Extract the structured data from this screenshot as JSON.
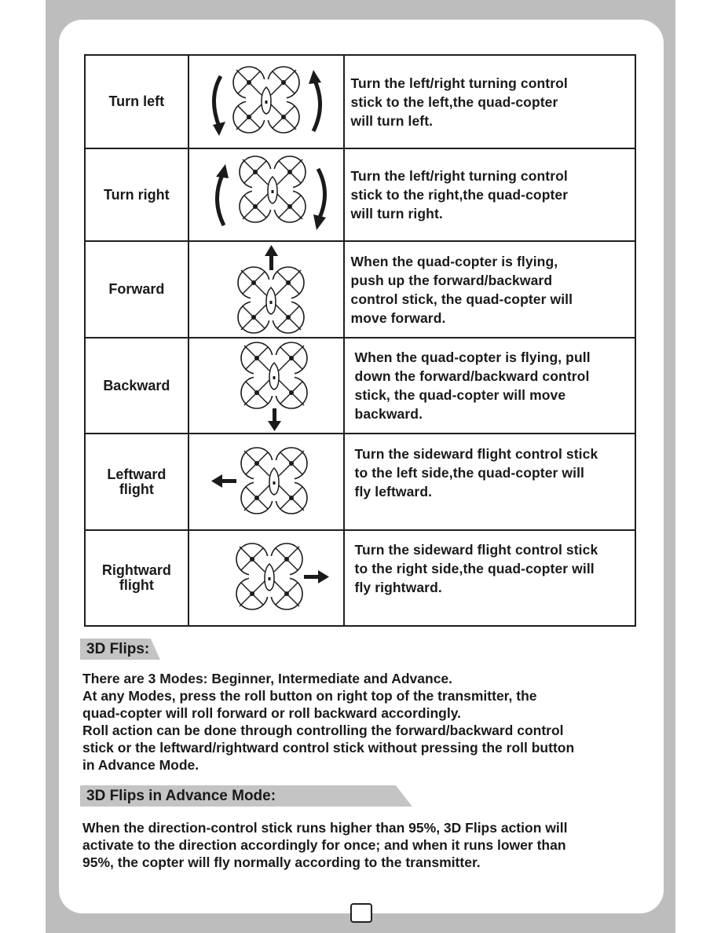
{
  "control_table": {
    "rows": [
      {
        "name": "Turn left",
        "direction": "rotate-counterclockwise",
        "description": [
          "Turn the left/right turning control",
          "stick to the left,the quad-copter",
          "will turn left."
        ]
      },
      {
        "name": "Turn right",
        "direction": "rotate-clockwise",
        "description": [
          "Turn the left/right turning control",
          "stick to the right,the quad-copter",
          "will turn right."
        ]
      },
      {
        "name": "Forward",
        "direction": "up",
        "description": [
          "When the quad-copter is flying,",
          "push up the forward/backward",
          "control stick, the quad-copter will",
          "move forward."
        ]
      },
      {
        "name": "Backward",
        "direction": "down",
        "description": [
          "When the quad-copter is flying, pull",
          "down the forward/backward control",
          "stick, the quad-copter will move",
          "backward."
        ]
      },
      {
        "name": "Leftward\nflight",
        "direction": "left",
        "description": [
          "Turn the sideward flight control stick",
          "to the left side,the quad-copter will",
          "fly leftward."
        ]
      },
      {
        "name": "Rightward\nflight",
        "direction": "right",
        "description": [
          "Turn the sideward flight control stick",
          "to the right side,the quad-copter will",
          "fly rightward."
        ]
      }
    ]
  },
  "section_3d_flips": {
    "heading": "3D Flips:",
    "lines": [
      "There are 3 Modes: Beginner, Intermediate and Advance.",
      "At any Modes, press the roll button on right top of the transmitter, the",
      "quad-copter will roll forward or roll backward accordingly.",
      "Roll action can be done through controlling the forward/backward control",
      "stick or the leftward/rightward control stick without pressing the roll button",
      "in Advance Mode."
    ]
  },
  "section_advance_mode": {
    "heading": "3D Flips in Advance Mode:",
    "lines": [
      "When the direction-control stick runs higher than 95%, 3D Flips action will",
      "activate to the direction accordingly for once; and when it runs lower than",
      "95%, the copter will fly normally according to the transmitter."
    ]
  },
  "page_number": ""
}
